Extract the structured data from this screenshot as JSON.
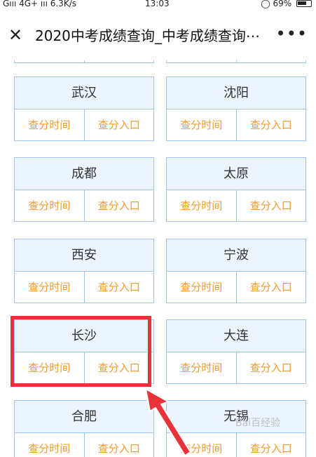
{
  "status_bar": {
    "left": "Gııı 4G+ ııı 6.3K/s",
    "time": "13:03",
    "battery": "69%"
  },
  "title_bar": {
    "close_icon": "close-icon",
    "title": "2020中考成绩查询_中考成绩查询⋯",
    "more_icon": "more-icon",
    "more_glyph": "•••"
  },
  "cards": [
    {
      "city": "武汉",
      "time_link": "查分时间",
      "entry_link": "查分入口"
    },
    {
      "city": "沈阳",
      "time_link": "查分时间",
      "entry_link": "查分入口"
    },
    {
      "city": "成都",
      "time_link": "查分时间",
      "entry_link": "查分入口"
    },
    {
      "city": "太原",
      "time_link": "查分时间",
      "entry_link": "查分入口"
    },
    {
      "city": "西安",
      "time_link": "查分时间",
      "entry_link": "查分入口"
    },
    {
      "city": "宁波",
      "time_link": "查分时间",
      "entry_link": "查分入口"
    },
    {
      "city": "长沙",
      "time_link": "查分时间",
      "entry_link": "查分入口"
    },
    {
      "city": "大连",
      "time_link": "查分时间",
      "entry_link": "查分入口"
    },
    {
      "city": "合肥",
      "time_link": "查分时间",
      "entry_link": "查分入口"
    },
    {
      "city": "无锡",
      "time_link": "查分时间",
      "entry_link": "查分入口"
    }
  ],
  "annotation": {
    "highlight_color": "#e8323a",
    "highlighted_city": "长沙"
  },
  "colors": {
    "card_border": "#9cc3f2",
    "card_header_bg": "#ecf4fd",
    "link_text": "#f39a31"
  },
  "watermark": "Bai百经验"
}
